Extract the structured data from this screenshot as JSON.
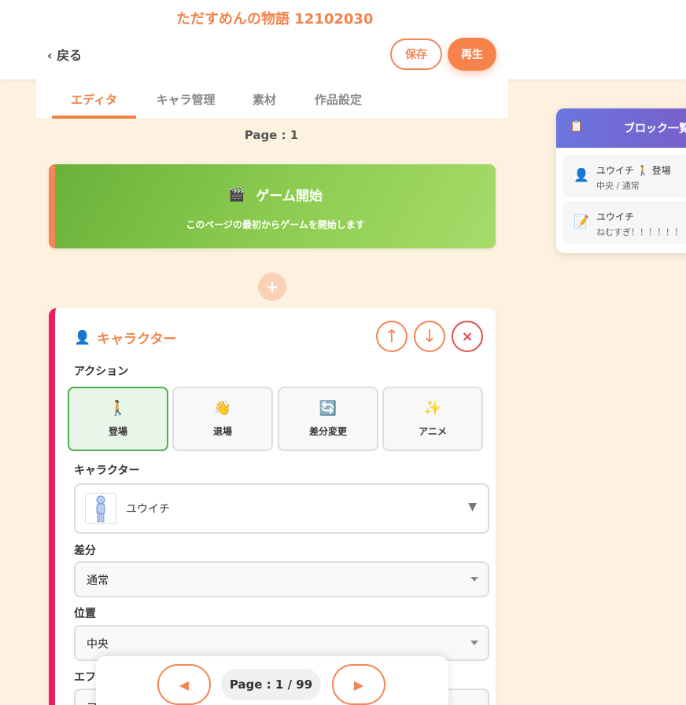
{
  "header": {
    "title": "ただすめんの物語 12102030",
    "back_label": "‹ 戻る",
    "save_label": "保存",
    "play_label": "再生"
  },
  "tabs": [
    {
      "label": "エディタ",
      "active": true
    },
    {
      "label": "キャラ管理",
      "active": false
    },
    {
      "label": "素材",
      "active": false
    },
    {
      "label": "作品設定",
      "active": false
    }
  ],
  "page_label": "Page : 1",
  "start_block": {
    "icon": "🎬",
    "title": "ゲーム開始",
    "description": "このページの最初からゲームを開始します"
  },
  "add_block_label": "+",
  "character_block": {
    "icon": "👤",
    "title": "キャラクター",
    "move_up_label": "↑",
    "move_down_label": "↓",
    "delete_label": "×",
    "action_label": "アクション",
    "actions": [
      {
        "icon": "🚶",
        "label": "登場",
        "selected": true
      },
      {
        "icon": "👋",
        "label": "退場",
        "selected": false
      },
      {
        "icon": "🔄",
        "label": "差分変更",
        "selected": false
      },
      {
        "icon": "✨",
        "label": "アニメ",
        "selected": false
      }
    ],
    "character_label": "キャラクター",
    "character_value": "ユウイチ",
    "character_caret": "▼",
    "variant_label": "差分",
    "variant_value": "通常",
    "position_label": "位置",
    "position_value": "中央",
    "effect_label": "エフ",
    "effect_value": "フ"
  },
  "pager": {
    "prev_label": "◀",
    "page_text": "Page : 1 / 99",
    "next_label": "▶"
  },
  "side_panel": {
    "icon": "📋",
    "title": "ブロック一覧",
    "items": [
      {
        "icon": "👤",
        "name": "ユウイチ 🚶 登場",
        "sub": "中央 / 通常"
      },
      {
        "icon": "📝",
        "name": "ユウイチ",
        "sub": "ねむすぎ！！！！！！"
      }
    ]
  },
  "colors": {
    "accent": "#f0844c",
    "background": "#fdf2e0",
    "start_green": "#8bcb4f",
    "character_border": "#e91e63",
    "selected_green": "#4caf50",
    "side_header": "#6a76de"
  }
}
